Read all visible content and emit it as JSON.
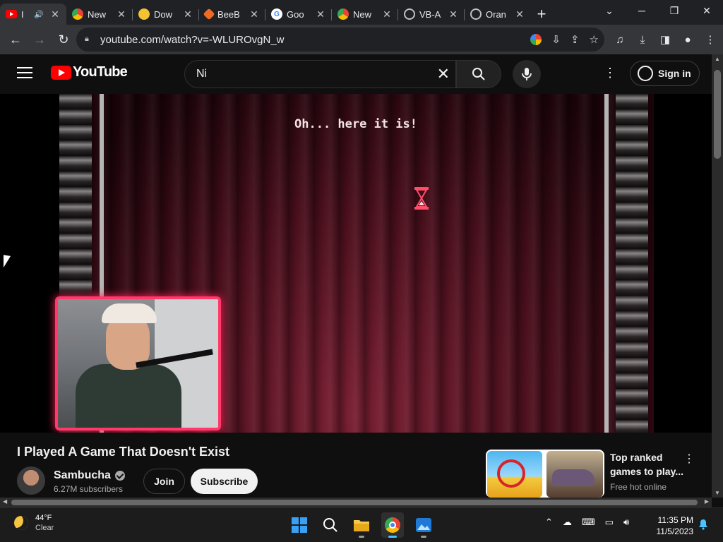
{
  "browser": {
    "tabs": [
      {
        "title": "I",
        "favicon": "youtube-icon",
        "active": true,
        "audio": true
      },
      {
        "title": "New",
        "favicon": "chrome-icon"
      },
      {
        "title": "Dow",
        "favicon": "bee-icon"
      },
      {
        "title": "BeeB",
        "favicon": "beebom-icon"
      },
      {
        "title": "Goo",
        "favicon": "google-icon"
      },
      {
        "title": "New",
        "favicon": "chrome-icon"
      },
      {
        "title": "VB-A",
        "favicon": "globe-icon"
      },
      {
        "title": "Oran",
        "favicon": "globe-icon"
      }
    ],
    "url": "youtube.com/watch?v=-WLUROvgN_w"
  },
  "youtube": {
    "logo_text": "YouTube",
    "search_value": "Ni",
    "sign_in": "Sign in",
    "colors": {
      "brand_red": "#ff0000",
      "cam_border": "#ff3a6a"
    }
  },
  "player": {
    "overlay_text": "Oh... here it is!"
  },
  "video": {
    "title": "I Played A Game That Doesn't Exist",
    "channel": "Sambucha",
    "subscribers": "6.27M subscribers",
    "join": "Join",
    "subscribe": "Subscribe"
  },
  "ad": {
    "title": "Top ranked games to play...",
    "subtitle": "Free hot online"
  },
  "taskbar": {
    "temperature": "44°F",
    "condition": "Clear",
    "time": "11:35 PM",
    "date": "11/5/2023"
  }
}
